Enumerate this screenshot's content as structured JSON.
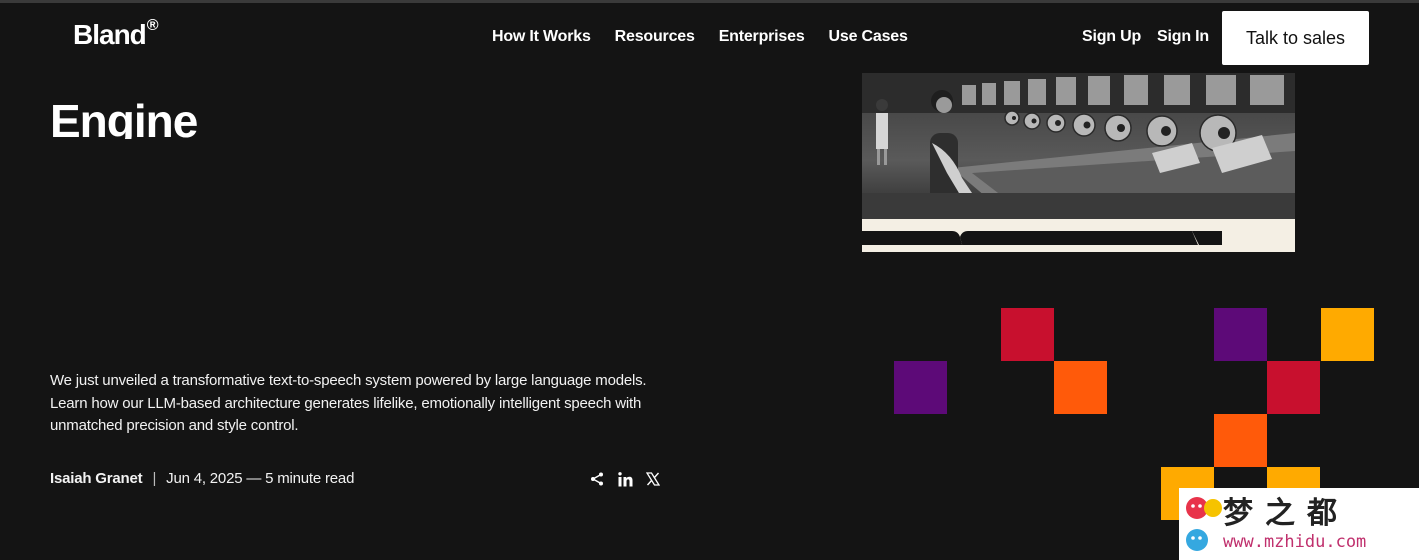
{
  "header": {
    "logo": "Bland",
    "logo_mark": "®",
    "nav": [
      "How It Works",
      "Resources",
      "Enterprises",
      "Use Cases"
    ],
    "sign_up": "Sign Up",
    "sign_in": "Sign In",
    "cta": "Talk to sales"
  },
  "hero": {
    "title": "Engine",
    "description": "We just unveiled a transformative text-to-speech system powered by large language models. Learn how our LLM-based architecture generates lifelike, emotionally intelligent speech with unmatched precision and style control.",
    "author": "Isaiah Granet",
    "separator": "|",
    "date_read": "Jun 4, 2025 — 5 minute read"
  },
  "share_icons": [
    "share-icon",
    "linkedin-icon",
    "x-icon"
  ],
  "colors": {
    "background": "#141414",
    "red": "#c8102e",
    "orange": "#ff5a0a",
    "purple": "#5d0a78",
    "yellow": "#ffaa00"
  },
  "watermark": {
    "text": "梦之都",
    "url": "www.mzhidu.com"
  }
}
